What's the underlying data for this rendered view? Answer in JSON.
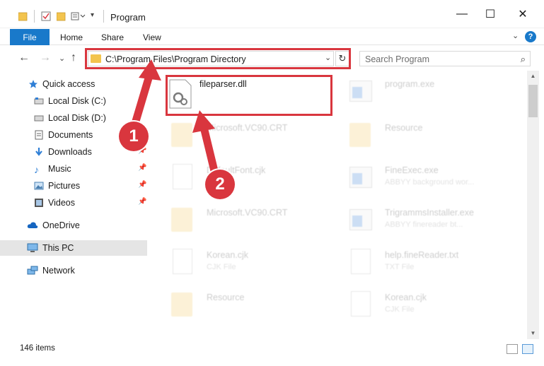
{
  "window": {
    "title": "Program",
    "minimize": "—",
    "maximize": "☐",
    "close": "✕"
  },
  "ribbon": {
    "tabs": [
      "File",
      "Home",
      "Share",
      "View"
    ],
    "help": "?",
    "collapse": "⌄"
  },
  "address": {
    "path": "C:\\Program Files\\Program Directory",
    "dropdown": "⌄",
    "refresh": "↻",
    "back": "←",
    "forward": "→",
    "recent": "⌄",
    "up": "↑"
  },
  "search": {
    "placeholder": "Search Program",
    "icon": "⌕"
  },
  "sidebar": {
    "items": [
      {
        "label": "Quick access",
        "icon": "star-icon",
        "pinned": false
      },
      {
        "label": "Local Disk (C:)",
        "icon": "drive-icon",
        "pinned": false
      },
      {
        "label": "Local Disk (D:)",
        "icon": "drive-icon",
        "pinned": false
      },
      {
        "label": "Documents",
        "icon": "documents-icon",
        "pinned": false
      },
      {
        "label": "Downloads",
        "icon": "downloads-icon",
        "pinned": true
      },
      {
        "label": "Music",
        "icon": "music-icon",
        "pinned": true
      },
      {
        "label": "Pictures",
        "icon": "pictures-icon",
        "pinned": true
      },
      {
        "label": "Videos",
        "icon": "videos-icon",
        "pinned": true
      },
      {
        "label": "OneDrive",
        "icon": "cloud-icon",
        "pinned": false
      },
      {
        "label": "This PC",
        "icon": "computer-icon",
        "pinned": false,
        "selected": true
      },
      {
        "label": "Network",
        "icon": "network-icon",
        "pinned": false
      }
    ],
    "pin_glyph": "📌"
  },
  "files": {
    "highlighted": {
      "name": "fileparser.dll"
    },
    "items": [
      {
        "name": "program.exe",
        "type": "",
        "icon": "exe-icon"
      },
      {
        "name": "Microsoft.VC90.CRT",
        "type": "",
        "icon": "folder-icon"
      },
      {
        "name": "Resource",
        "type": "",
        "icon": "folder-icon"
      },
      {
        "name": "DefaultFont.cjk",
        "type": "CJK File",
        "icon": "document-icon"
      },
      {
        "name": "FineExec.exe",
        "type": "ABBYY background wor...",
        "icon": "exe-icon"
      },
      {
        "name": "Microsoft.VC90.CRT",
        "type": "",
        "icon": "folder-icon"
      },
      {
        "name": "TrigrammsInstaller.exe",
        "type": "ABBYY finereader bt...",
        "icon": "exe-icon"
      },
      {
        "name": "Korean.cjk",
        "type": "CJK File",
        "icon": "document-icon"
      },
      {
        "name": "help.fineReader.txt",
        "type": "TXT File",
        "icon": "document-icon"
      },
      {
        "name": "Resource",
        "type": "",
        "icon": "folder-icon"
      },
      {
        "name": "Korean.cjk",
        "type": "CJK File",
        "icon": "document-icon"
      }
    ]
  },
  "status": {
    "count": "146 items"
  },
  "annotations": {
    "step1": "1",
    "step2": "2",
    "color": "#d9363e"
  },
  "colors": {
    "accent": "#1979ca",
    "highlight": "#d9363e",
    "folder": "#f3c44e"
  }
}
